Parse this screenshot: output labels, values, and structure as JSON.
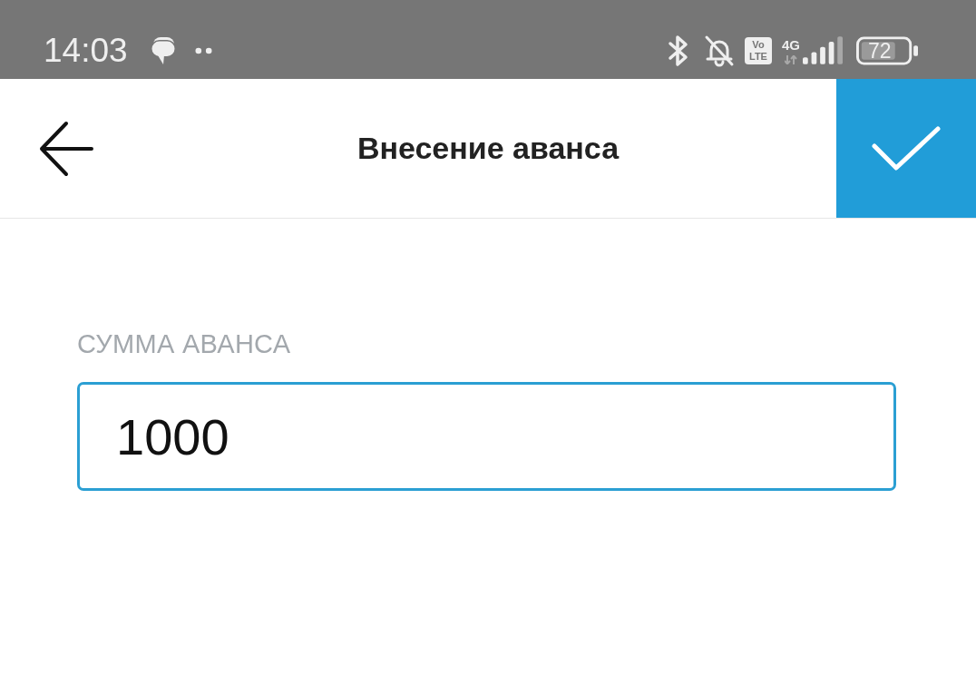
{
  "status_bar": {
    "time": "14:03",
    "volte": "Vo LTE",
    "network": "4G",
    "battery": "72"
  },
  "header": {
    "title": "Внесение аванса"
  },
  "form": {
    "field": {
      "label": "СУММА АВАНСА",
      "value": "1000",
      "focused": true
    }
  }
}
